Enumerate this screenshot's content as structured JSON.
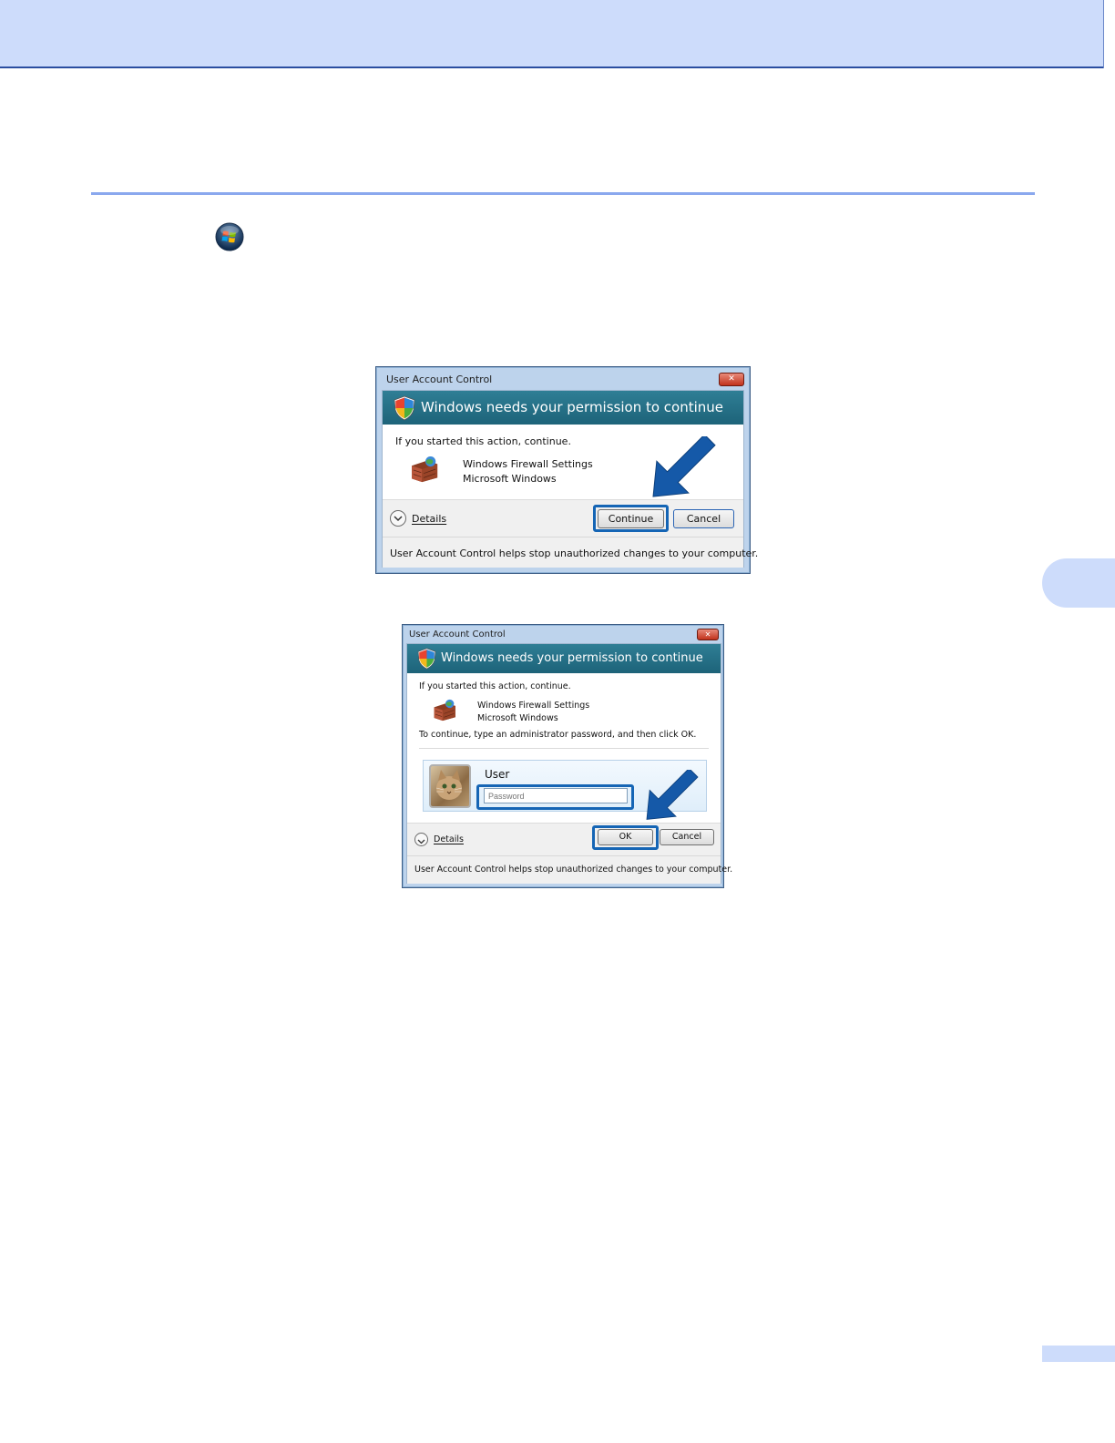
{
  "dialog1": {
    "title": "User Account Control",
    "close": "✕",
    "banner": "Windows needs your permission to continue",
    "prompt": "If you started this action, continue.",
    "program_name": "Windows Firewall Settings",
    "publisher": "Microsoft Windows",
    "details_label": "Details",
    "continue_label": "Continue",
    "cancel_label": "Cancel",
    "footer": "User Account Control helps stop unauthorized changes to your computer."
  },
  "dialog2": {
    "title": "User Account Control",
    "close": "✕",
    "banner": "Windows needs your permission to continue",
    "prompt": "If you started this action, continue.",
    "program_name": "Windows Firewall Settings",
    "publisher": "Microsoft Windows",
    "instruction": "To continue, type an administrator password, and then click OK.",
    "user_name": "User",
    "password_placeholder": "Password",
    "details_label": "Details",
    "ok_label": "OK",
    "cancel_label": "Cancel",
    "footer": "User Account Control helps stop unauthorized changes to your computer."
  },
  "colors": {
    "header_band": "#cddcfb",
    "rule": "#8aa8ee",
    "banner": "#1d6379",
    "highlight": "#1565b5"
  }
}
